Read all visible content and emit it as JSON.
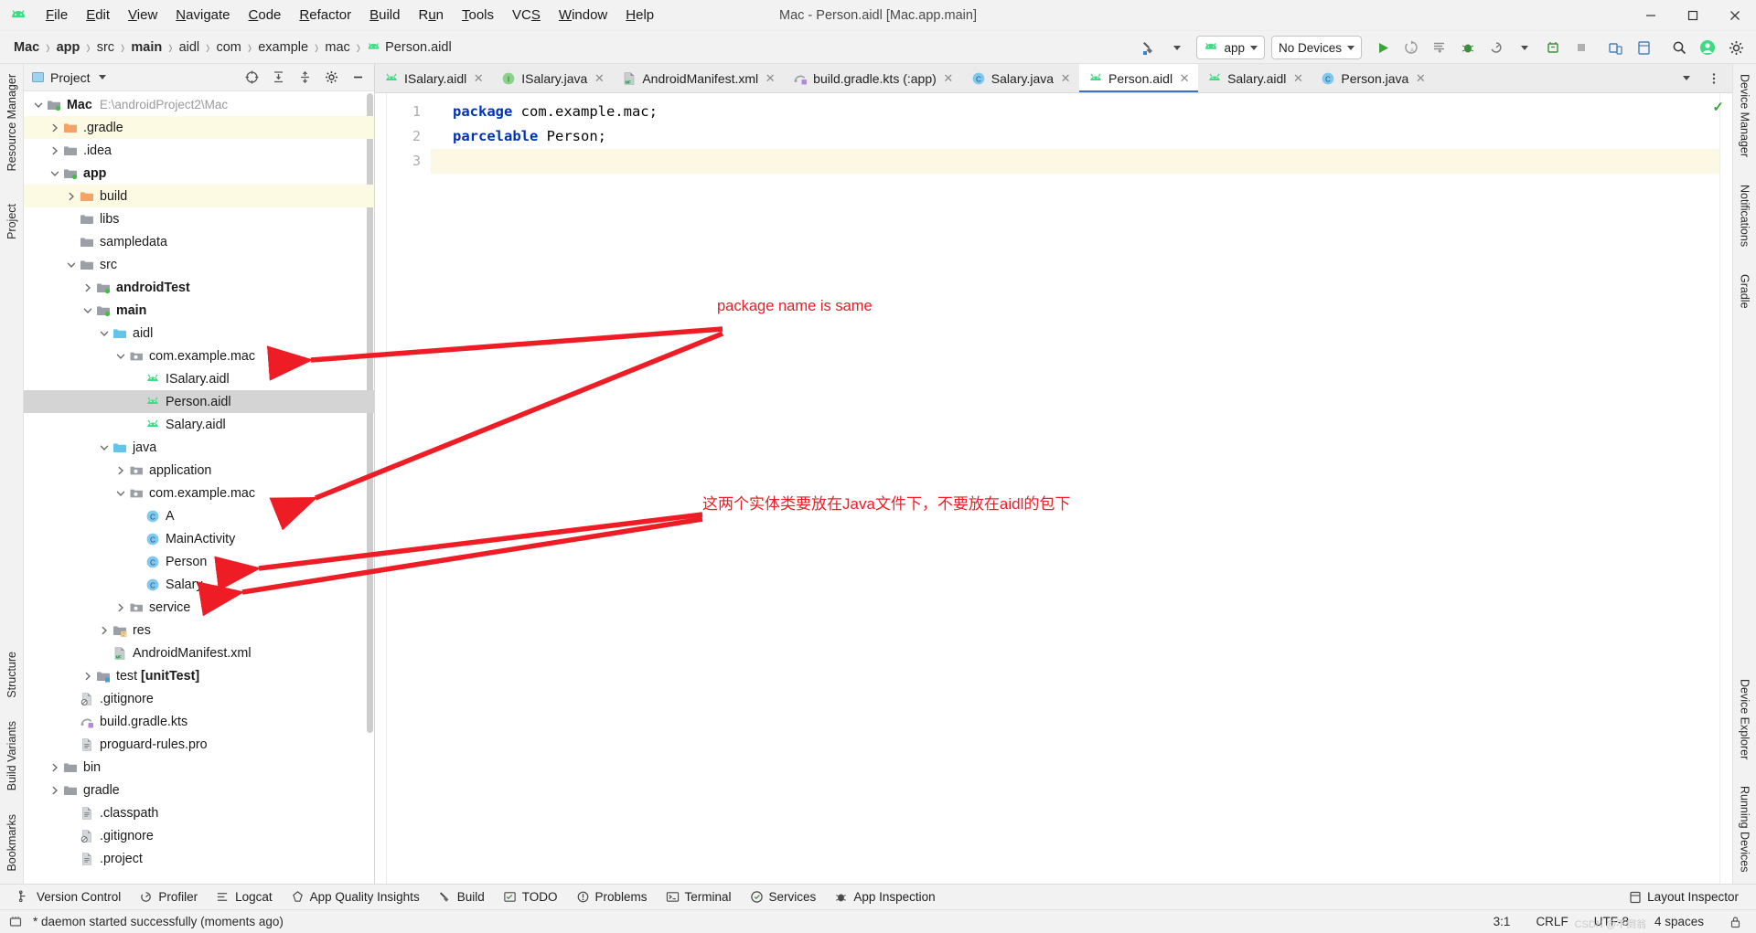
{
  "window": {
    "title": "Mac - Person.aidl [Mac.app.main]",
    "controls": {
      "minimize": "─",
      "maximize": "☐",
      "close": "✕"
    }
  },
  "menubar": {
    "items": [
      {
        "label": "File",
        "mnemonic": "F"
      },
      {
        "label": "Edit",
        "mnemonic": "E"
      },
      {
        "label": "View",
        "mnemonic": "V"
      },
      {
        "label": "Navigate",
        "mnemonic": "N"
      },
      {
        "label": "Code",
        "mnemonic": "C"
      },
      {
        "label": "Refactor",
        "mnemonic": "R"
      },
      {
        "label": "Build",
        "mnemonic": "B"
      },
      {
        "label": "Run",
        "mnemonic": "u"
      },
      {
        "label": "Tools",
        "mnemonic": "T"
      },
      {
        "label": "VCS",
        "mnemonic": "S"
      },
      {
        "label": "Window",
        "mnemonic": "W"
      },
      {
        "label": "Help",
        "mnemonic": "H"
      }
    ]
  },
  "breadcrumb": {
    "items": [
      "Mac",
      "app",
      "src",
      "main",
      "aidl",
      "com",
      "example",
      "mac",
      "Person.aidl"
    ],
    "bold_indices": [
      0,
      1,
      3
    ]
  },
  "toolbar": {
    "build_variant_label": "",
    "run_config": "app",
    "device": "No Devices",
    "icons": [
      "hammer-icon",
      "run-icon",
      "rerun-icon",
      "run-with-coverage-icon",
      "debug-icon",
      "profile-icon",
      "attach-debugger-icon",
      "stop-icon",
      "device-manager-icon",
      "layout-inspector-icon",
      "search-everywhere-icon",
      "settings-icon"
    ]
  },
  "project_panel": {
    "title": "Project",
    "head_icons": [
      "select-opened-file-icon",
      "expand-all-icon",
      "collapse-all-icon",
      "settings-icon",
      "hide-icon"
    ],
    "tree": [
      {
        "indent": 0,
        "twist": "down",
        "icon": "module-folder-icon",
        "label": "Mac",
        "bold": true,
        "path": "E:\\androidProject2\\Mac"
      },
      {
        "indent": 1,
        "twist": "right",
        "icon": "orange-folder-icon",
        "label": ".gradle",
        "highlight": true
      },
      {
        "indent": 1,
        "twist": "right",
        "icon": "folder-icon",
        "label": ".idea"
      },
      {
        "indent": 1,
        "twist": "down",
        "icon": "module-folder-icon",
        "label": "app",
        "bold": true
      },
      {
        "indent": 2,
        "twist": "right",
        "icon": "orange-folder-icon",
        "label": "build",
        "highlight": true
      },
      {
        "indent": 2,
        "twist": "none",
        "icon": "folder-icon",
        "label": "libs"
      },
      {
        "indent": 2,
        "twist": "none",
        "icon": "folder-icon",
        "label": "sampledata"
      },
      {
        "indent": 2,
        "twist": "down",
        "icon": "folder-icon",
        "label": "src"
      },
      {
        "indent": 3,
        "twist": "right",
        "icon": "module-folder-icon",
        "label": "androidTest",
        "bold": true
      },
      {
        "indent": 3,
        "twist": "down",
        "icon": "module-folder-icon",
        "label": "main",
        "bold": true
      },
      {
        "indent": 4,
        "twist": "down",
        "icon": "source-folder-icon",
        "label": "aidl"
      },
      {
        "indent": 5,
        "twist": "down",
        "icon": "package-icon",
        "label": "com.example.mac"
      },
      {
        "indent": 6,
        "twist": "none",
        "icon": "aidl-icon",
        "label": "ISalary.aidl"
      },
      {
        "indent": 6,
        "twist": "none",
        "icon": "aidl-icon",
        "label": "Person.aidl",
        "selected": true
      },
      {
        "indent": 6,
        "twist": "none",
        "icon": "aidl-icon",
        "label": "Salary.aidl"
      },
      {
        "indent": 4,
        "twist": "down",
        "icon": "source-folder-icon",
        "label": "java"
      },
      {
        "indent": 5,
        "twist": "right",
        "icon": "package-icon",
        "label": "application"
      },
      {
        "indent": 5,
        "twist": "down",
        "icon": "package-icon",
        "label": "com.example.mac"
      },
      {
        "indent": 6,
        "twist": "none",
        "icon": "java-class-icon",
        "label": "A"
      },
      {
        "indent": 6,
        "twist": "none",
        "icon": "java-class-icon",
        "label": "MainActivity"
      },
      {
        "indent": 6,
        "twist": "none",
        "icon": "java-class-icon",
        "label": "Person"
      },
      {
        "indent": 6,
        "twist": "none",
        "icon": "java-class-icon",
        "label": "Salary"
      },
      {
        "indent": 5,
        "twist": "right",
        "icon": "package-icon",
        "label": "service"
      },
      {
        "indent": 4,
        "twist": "right",
        "icon": "res-folder-icon",
        "label": "res"
      },
      {
        "indent": 4,
        "twist": "none",
        "icon": "manifest-icon",
        "label": "AndroidManifest.xml"
      },
      {
        "indent": 3,
        "twist": "right",
        "icon": "test-module-folder-icon",
        "label": "test [unitTest]",
        "bold_suffix": "[unitTest]",
        "bold_prefix": "test "
      },
      {
        "indent": 2,
        "twist": "none",
        "icon": "gitignore-icon",
        "label": ".gitignore"
      },
      {
        "indent": 2,
        "twist": "none",
        "icon": "gradle-kts-icon",
        "label": "build.gradle.kts"
      },
      {
        "indent": 2,
        "twist": "none",
        "icon": "file-icon",
        "label": "proguard-rules.pro"
      },
      {
        "indent": 1,
        "twist": "right",
        "icon": "folder-icon",
        "label": "bin"
      },
      {
        "indent": 1,
        "twist": "right",
        "icon": "folder-icon",
        "label": "gradle"
      },
      {
        "indent": 2,
        "twist": "none",
        "icon": "file-icon",
        "label": ".classpath"
      },
      {
        "indent": 2,
        "twist": "none",
        "icon": "gitignore-icon",
        "label": ".gitignore"
      },
      {
        "indent": 2,
        "twist": "none",
        "icon": "file-icon",
        "label": ".project"
      }
    ]
  },
  "editor": {
    "tabs": [
      {
        "label": "ISalary.aidl",
        "icon": "aidl-icon",
        "active": false
      },
      {
        "label": "ISalary.java",
        "icon": "interface-icon",
        "active": false
      },
      {
        "label": "AndroidManifest.xml",
        "icon": "manifest-icon",
        "active": false
      },
      {
        "label": "build.gradle.kts (:app)",
        "icon": "gradle-kts-icon",
        "active": false
      },
      {
        "label": "Salary.java",
        "icon": "class-icon",
        "active": false
      },
      {
        "label": "Person.aidl",
        "icon": "aidl-icon",
        "active": true
      },
      {
        "label": "Salary.aidl",
        "icon": "aidl-icon",
        "active": false
      },
      {
        "label": "Person.java",
        "icon": "class-icon",
        "active": false
      }
    ],
    "line_numbers": [
      "1",
      "2",
      "3"
    ],
    "code": [
      {
        "tokens": [
          {
            "t": "package",
            "k": true
          },
          {
            "t": " com.example.mac;",
            "k": false
          }
        ]
      },
      {
        "tokens": [
          {
            "t": "parcelable",
            "k": true
          },
          {
            "t": " Person;",
            "k": false
          }
        ]
      },
      {
        "tokens": []
      }
    ],
    "inspection_status": "✓"
  },
  "annotations": [
    {
      "id": "anno-package-name",
      "text": "package name is same",
      "lang": "en"
    },
    {
      "id": "anno-entity-class",
      "text": "这两个实体类要放在Java文件下，不要放在aidl的包下",
      "lang": "zh"
    }
  ],
  "left_strip": {
    "items": [
      {
        "label": "Resource Manager",
        "icon": "resource-manager-icon"
      },
      {
        "label": "Project",
        "icon": "project-icon"
      }
    ],
    "bottom_items": [
      {
        "label": "Bookmarks",
        "icon": "bookmarks-icon"
      },
      {
        "label": "Build Variants",
        "icon": "build-variants-icon"
      },
      {
        "label": "Structure",
        "icon": "structure-icon"
      }
    ]
  },
  "right_strip": {
    "items": [
      {
        "label": "Device Manager",
        "icon": "device-manager-icon"
      },
      {
        "label": "Notifications",
        "icon": "notifications-icon"
      },
      {
        "label": "Gradle",
        "icon": "gradle-icon"
      }
    ],
    "bottom_items": [
      {
        "label": "Device Explorer",
        "icon": "device-explorer-icon"
      },
      {
        "label": "Running Devices",
        "icon": "running-devices-icon"
      }
    ]
  },
  "bottom_bar": {
    "items": [
      {
        "label": "Version Control",
        "icon": "branch-icon"
      },
      {
        "label": "Profiler",
        "icon": "profiler-icon"
      },
      {
        "label": "Logcat",
        "icon": "logcat-icon"
      },
      {
        "label": "App Quality Insights",
        "icon": "quality-insights-icon"
      },
      {
        "label": "Build",
        "icon": "build-icon"
      },
      {
        "label": "TODO",
        "icon": "todo-icon"
      },
      {
        "label": "Problems",
        "icon": "problems-icon"
      },
      {
        "label": "Terminal",
        "icon": "terminal-icon"
      },
      {
        "label": "Services",
        "icon": "services-icon"
      },
      {
        "label": "App Inspection",
        "icon": "app-inspection-icon"
      }
    ],
    "right": {
      "label": "Layout Inspector",
      "icon": "layout-inspector-icon"
    }
  },
  "status_bar": {
    "message": "* daemon started successfully (moments ago)",
    "caret": "3:1",
    "line_separator": "CRLF",
    "encoding": "UTF-8",
    "indent": "4 spaces",
    "watermark": "CSDN @不倒翁"
  }
}
